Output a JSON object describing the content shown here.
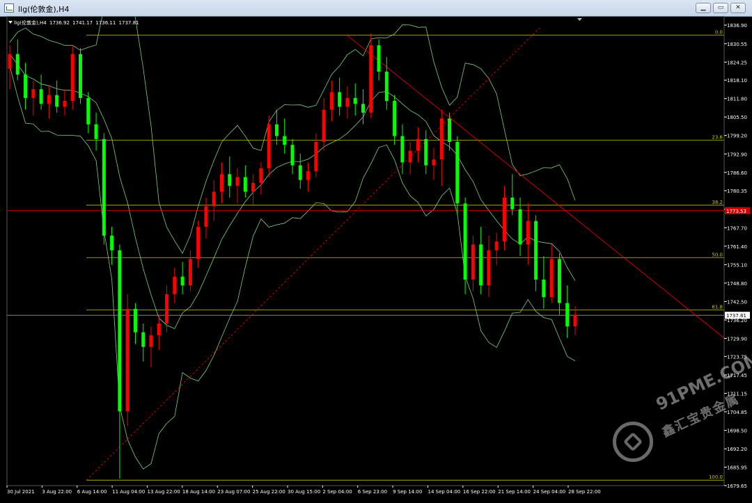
{
  "window": {
    "title": "llg(伦敦金),H4",
    "buttons": {
      "minimize": "▁",
      "maximize": "▭",
      "close": "✕"
    }
  },
  "ohlc": {
    "symbol": "llg(伦敦金),H4",
    "open": "1736.92",
    "high": "1741.17",
    "low": "1736.11",
    "close": "1737.81"
  },
  "price_axis": {
    "ticks": [
      "1836.90",
      "1830.55",
      "1824.25",
      "1818.10",
      "1811.80",
      "1805.50",
      "1799.20",
      "1792.90",
      "1786.60",
      "1780.35",
      "1774.00",
      "1767.70",
      "1761.40",
      "1755.10",
      "1748.80",
      "1742.50",
      "1736.20",
      "1729.90",
      "1723.75",
      "1717.45",
      "1711.15",
      "1704.85",
      "1698.50",
      "1692.20",
      "1685.95",
      "1679.65"
    ],
    "current_price": "1737.81",
    "level_price": "1773.53"
  },
  "time_axis": {
    "labels": [
      "30 Jul 2021",
      "3 Aug 22:00",
      "6 Aug 14:00",
      "11 Aug 04:00",
      "13 Aug 22:00",
      "18 Aug 14:00",
      "23 Aug 07:00",
      "25 Aug 22:00",
      "30 Aug 15:00",
      "2 Sep 04:00",
      "6 Sep 23:00",
      "9 Sep 14:00",
      "14 Sep 04:00",
      "16 Sep 22:00",
      "21 Sep 14:00",
      "24 Sep 04:00",
      "28 Sep 22:00"
    ]
  },
  "fibonacci": {
    "levels": [
      {
        "label": "0.0",
        "price": 1833.5
      },
      {
        "label": "23.6",
        "price": 1797.6
      },
      {
        "label": "38.2",
        "price": 1775.4
      },
      {
        "label": "50.0",
        "price": 1757.5
      },
      {
        "label": "61.8",
        "price": 1739.6
      },
      {
        "label": "100.0",
        "price": 1681.5
      }
    ]
  },
  "colors": {
    "background": "#000000",
    "bull": "#ff0000",
    "bear": "#00ff00",
    "fib": "#c8c800",
    "band": "#7fd17f",
    "trend": "#d00000",
    "price_line": "#9a9a9a",
    "axis_text": "#ffffff"
  },
  "watermark": {
    "domain": "91PME.COM",
    "cn": "鑫汇宝贵金属"
  },
  "chart_data": {
    "type": "candlestick",
    "ylim": [
      1679.65,
      1840.0
    ],
    "candles": [
      {
        "o": 1822,
        "h": 1830,
        "l": 1815,
        "c": 1827
      },
      {
        "o": 1827,
        "h": 1832,
        "l": 1818,
        "c": 1820
      },
      {
        "o": 1820,
        "h": 1824,
        "l": 1808,
        "c": 1812
      },
      {
        "o": 1812,
        "h": 1818,
        "l": 1806,
        "c": 1815
      },
      {
        "o": 1815,
        "h": 1820,
        "l": 1808,
        "c": 1810
      },
      {
        "o": 1810,
        "h": 1816,
        "l": 1805,
        "c": 1813
      },
      {
        "o": 1813,
        "h": 1818,
        "l": 1807,
        "c": 1809
      },
      {
        "o": 1809,
        "h": 1815,
        "l": 1806,
        "c": 1811
      },
      {
        "o": 1811,
        "h": 1830,
        "l": 1808,
        "c": 1827
      },
      {
        "o": 1827,
        "h": 1829,
        "l": 1810,
        "c": 1812
      },
      {
        "o": 1812,
        "h": 1814,
        "l": 1800,
        "c": 1803
      },
      {
        "o": 1803,
        "h": 1807,
        "l": 1794,
        "c": 1798
      },
      {
        "o": 1798,
        "h": 1800,
        "l": 1762,
        "c": 1765
      },
      {
        "o": 1765,
        "h": 1768,
        "l": 1755,
        "c": 1760
      },
      {
        "o": 1760,
        "h": 1762,
        "l": 1682,
        "c": 1705
      },
      {
        "o": 1705,
        "h": 1745,
        "l": 1700,
        "c": 1740
      },
      {
        "o": 1740,
        "h": 1742,
        "l": 1728,
        "c": 1732
      },
      {
        "o": 1732,
        "h": 1735,
        "l": 1722,
        "c": 1727
      },
      {
        "o": 1727,
        "h": 1734,
        "l": 1720,
        "c": 1731
      },
      {
        "o": 1731,
        "h": 1738,
        "l": 1726,
        "c": 1735
      },
      {
        "o": 1735,
        "h": 1748,
        "l": 1732,
        "c": 1745
      },
      {
        "o": 1745,
        "h": 1754,
        "l": 1742,
        "c": 1751
      },
      {
        "o": 1751,
        "h": 1756,
        "l": 1745,
        "c": 1748
      },
      {
        "o": 1748,
        "h": 1760,
        "l": 1746,
        "c": 1757
      },
      {
        "o": 1757,
        "h": 1770,
        "l": 1754,
        "c": 1768
      },
      {
        "o": 1768,
        "h": 1778,
        "l": 1764,
        "c": 1775
      },
      {
        "o": 1775,
        "h": 1784,
        "l": 1770,
        "c": 1780
      },
      {
        "o": 1780,
        "h": 1790,
        "l": 1776,
        "c": 1786
      },
      {
        "o": 1786,
        "h": 1792,
        "l": 1778,
        "c": 1782
      },
      {
        "o": 1782,
        "h": 1788,
        "l": 1776,
        "c": 1785
      },
      {
        "o": 1785,
        "h": 1789,
        "l": 1778,
        "c": 1780
      },
      {
        "o": 1780,
        "h": 1786,
        "l": 1775,
        "c": 1783
      },
      {
        "o": 1783,
        "h": 1790,
        "l": 1779,
        "c": 1788
      },
      {
        "o": 1788,
        "h": 1806,
        "l": 1785,
        "c": 1803
      },
      {
        "o": 1803,
        "h": 1808,
        "l": 1796,
        "c": 1799
      },
      {
        "o": 1799,
        "h": 1805,
        "l": 1793,
        "c": 1796
      },
      {
        "o": 1796,
        "h": 1798,
        "l": 1786,
        "c": 1789
      },
      {
        "o": 1789,
        "h": 1793,
        "l": 1781,
        "c": 1784
      },
      {
        "o": 1784,
        "h": 1790,
        "l": 1780,
        "c": 1787
      },
      {
        "o": 1787,
        "h": 1800,
        "l": 1785,
        "c": 1797
      },
      {
        "o": 1797,
        "h": 1812,
        "l": 1794,
        "c": 1808
      },
      {
        "o": 1808,
        "h": 1818,
        "l": 1804,
        "c": 1814
      },
      {
        "o": 1814,
        "h": 1819,
        "l": 1806,
        "c": 1809
      },
      {
        "o": 1809,
        "h": 1816,
        "l": 1805,
        "c": 1812
      },
      {
        "o": 1812,
        "h": 1817,
        "l": 1806,
        "c": 1810
      },
      {
        "o": 1810,
        "h": 1815,
        "l": 1803,
        "c": 1807
      },
      {
        "o": 1807,
        "h": 1834,
        "l": 1805,
        "c": 1830
      },
      {
        "o": 1830,
        "h": 1832,
        "l": 1818,
        "c": 1821
      },
      {
        "o": 1821,
        "h": 1826,
        "l": 1808,
        "c": 1811
      },
      {
        "o": 1811,
        "h": 1813,
        "l": 1796,
        "c": 1799
      },
      {
        "o": 1799,
        "h": 1803,
        "l": 1786,
        "c": 1790
      },
      {
        "o": 1790,
        "h": 1797,
        "l": 1786,
        "c": 1794
      },
      {
        "o": 1794,
        "h": 1802,
        "l": 1790,
        "c": 1798
      },
      {
        "o": 1798,
        "h": 1801,
        "l": 1786,
        "c": 1789
      },
      {
        "o": 1789,
        "h": 1795,
        "l": 1784,
        "c": 1791
      },
      {
        "o": 1791,
        "h": 1808,
        "l": 1782,
        "c": 1805
      },
      {
        "o": 1805,
        "h": 1807,
        "l": 1794,
        "c": 1797
      },
      {
        "o": 1797,
        "h": 1799,
        "l": 1772,
        "c": 1776
      },
      {
        "o": 1776,
        "h": 1778,
        "l": 1745,
        "c": 1750
      },
      {
        "o": 1750,
        "h": 1765,
        "l": 1746,
        "c": 1762
      },
      {
        "o": 1762,
        "h": 1768,
        "l": 1745,
        "c": 1748
      },
      {
        "o": 1748,
        "h": 1765,
        "l": 1744,
        "c": 1760
      },
      {
        "o": 1760,
        "h": 1766,
        "l": 1755,
        "c": 1763
      },
      {
        "o": 1763,
        "h": 1782,
        "l": 1760,
        "c": 1778
      },
      {
        "o": 1778,
        "h": 1786,
        "l": 1772,
        "c": 1774
      },
      {
        "o": 1774,
        "h": 1778,
        "l": 1758,
        "c": 1762
      },
      {
        "o": 1762,
        "h": 1776,
        "l": 1755,
        "c": 1770
      },
      {
        "o": 1770,
        "h": 1772,
        "l": 1746,
        "c": 1750
      },
      {
        "o": 1750,
        "h": 1758,
        "l": 1740,
        "c": 1744
      },
      {
        "o": 1744,
        "h": 1762,
        "l": 1742,
        "c": 1757
      },
      {
        "o": 1757,
        "h": 1759,
        "l": 1738,
        "c": 1742
      },
      {
        "o": 1742,
        "h": 1748,
        "l": 1730,
        "c": 1734
      },
      {
        "o": 1734,
        "h": 1741,
        "l": 1731,
        "c": 1738
      }
    ]
  }
}
